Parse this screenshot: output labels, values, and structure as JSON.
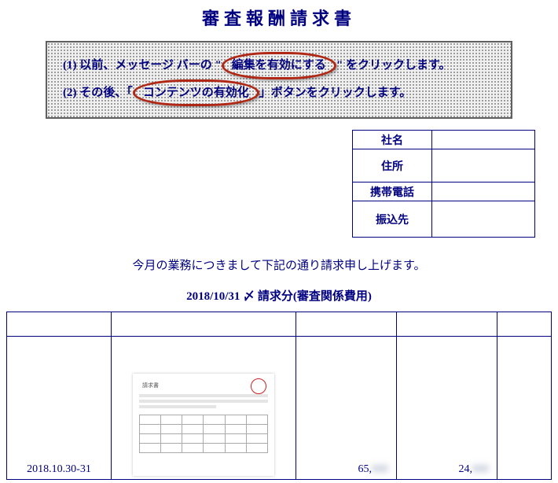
{
  "title": "審査報酬請求書",
  "inst": {
    "l1a": "(1) 以前、メッセージ バーの \"",
    "l1h": "編集を有効にする",
    "l1b": "\" をクリックします。",
    "l2a": "(2) その後、「",
    "l2h": "コンテンツの有効化",
    "l2b": "」ボタンをクリックします。"
  },
  "info": {
    "company": "社名",
    "address": "住所",
    "phone": "携帯電話",
    "bank": "振込先"
  },
  "lead": "今月の業務につきまして下記の通り請求申し上げます。",
  "subtitle": "2018/10/31 〆 請求分(審査関係費用)",
  "row": {
    "date": "2018.10.30-31",
    "thumb_label": "請求書",
    "v3_visible": "65,",
    "v3_blur": "000",
    "v4_visible": "24,",
    "v4_blur": "000"
  }
}
